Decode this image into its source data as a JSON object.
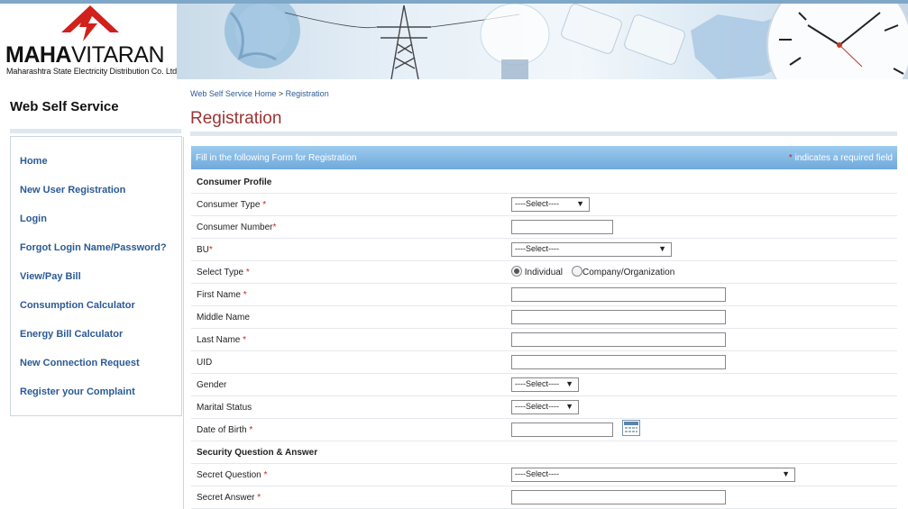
{
  "header": {
    "brand_bold": "MAHA",
    "brand_rest": "VITARAN",
    "brand_subtitle": "Maharashtra State Electricity Distribution Co. Ltd.",
    "logo_color": "#d0211c"
  },
  "sidebar": {
    "title": "Web Self Service",
    "items": [
      {
        "label": "Home"
      },
      {
        "label": "New User Registration"
      },
      {
        "label": "Login"
      },
      {
        "label": "Forgot Login Name/Password?"
      },
      {
        "label": "View/Pay Bill"
      },
      {
        "label": "Consumption Calculator"
      },
      {
        "label": "Energy Bill Calculator"
      },
      {
        "label": "New Connection Request"
      },
      {
        "label": "Register your Complaint"
      }
    ]
  },
  "breadcrumb": {
    "home": "Web Self Service Home",
    "separator": ">",
    "current": "Registration"
  },
  "page": {
    "title": "Registration"
  },
  "form": {
    "header_left": "Fill in the following Form for Registration",
    "required_marker": "*",
    "header_right": "indicates a required field",
    "section_profile": "Consumer Profile",
    "section_security": "Security Question & Answer",
    "consumer_type": {
      "label": "Consumer Type",
      "value": "----Select----"
    },
    "consumer_number": {
      "label": "Consumer Number",
      "value": ""
    },
    "bu": {
      "label": "BU",
      "value": "----Select----"
    },
    "select_type": {
      "label": "Select Type",
      "options": [
        "Individual",
        "Company/Organization"
      ],
      "selected": "Individual"
    },
    "first_name": {
      "label": "First Name",
      "value": ""
    },
    "middle_name": {
      "label": "Middle Name",
      "value": ""
    },
    "last_name": {
      "label": "Last Name",
      "value": ""
    },
    "uid": {
      "label": "UID",
      "value": ""
    },
    "gender": {
      "label": "Gender",
      "value": "----Select----"
    },
    "marital_status": {
      "label": "Marital Status",
      "value": "----Select----"
    },
    "dob": {
      "label": "Date of Birth",
      "value": ""
    },
    "secret_question": {
      "label": "Secret Question",
      "value": "----Select----"
    },
    "secret_answer": {
      "label": "Secret Answer",
      "value": ""
    }
  }
}
